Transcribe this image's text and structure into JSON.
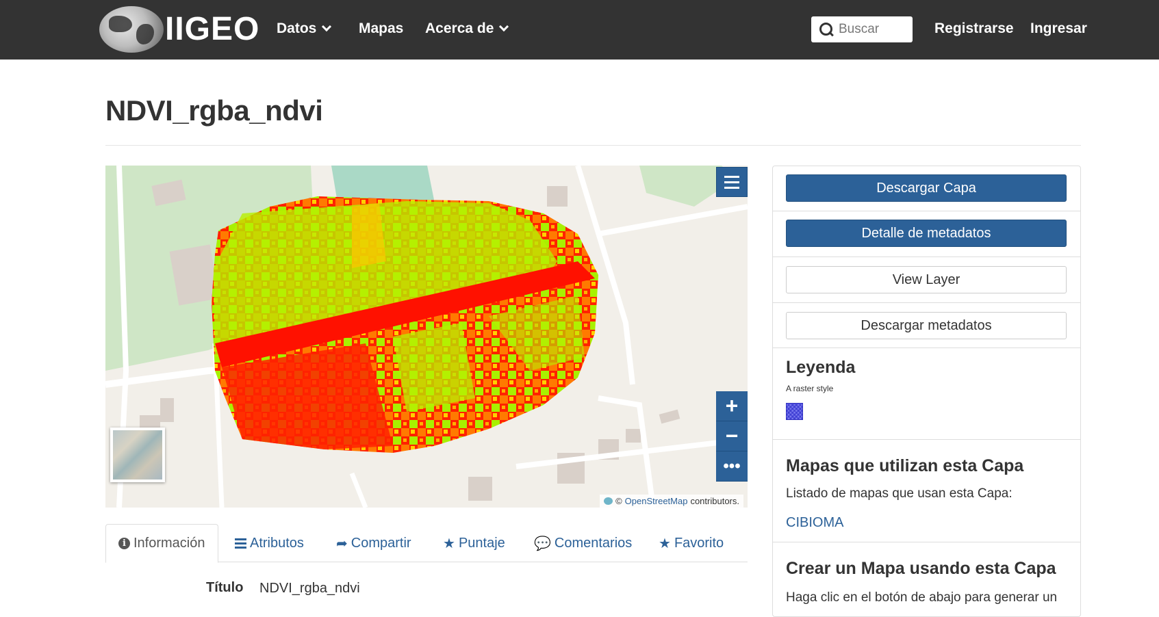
{
  "navbar": {
    "logo_text": "IIGEO",
    "datos": "Datos",
    "mapas": "Mapas",
    "acerca": "Acerca de",
    "search_placeholder": "Buscar",
    "registrarse": "Registrarse",
    "ingresar": "Ingresar"
  },
  "page": {
    "title": "NDVI_rgba_ndvi"
  },
  "map": {
    "attribution_prefix": "©",
    "attribution_link": "OpenStreetMap",
    "attribution_suffix": "contributors."
  },
  "tabs": [
    {
      "label": "Información"
    },
    {
      "label": "Atributos"
    },
    {
      "label": "Compartir"
    },
    {
      "label": "Puntaje"
    },
    {
      "label": "Comentarios"
    },
    {
      "label": "Favorito"
    }
  ],
  "info": {
    "title_label": "Título",
    "title_value": "NDVI_rgba_ndvi"
  },
  "sidebar": {
    "descargar_capa": "Descargar Capa",
    "detalle_metadatos": "Detalle de metadatos",
    "view_layer": "View Layer",
    "descargar_metadatos": "Descargar metadatos",
    "legend_title": "Leyenda",
    "legend_sub": "A raster style",
    "maps_title": "Mapas que utilizan esta Capa",
    "maps_text": "Listado de mapas que usan esta Capa:",
    "maps_link": "CIBIOMA",
    "create_title": "Crear un Mapa usando esta Capa",
    "create_text": "Haga clic en el botón de abajo para generar un"
  },
  "colors": {
    "navbar": "#333333",
    "primary": "#2c6198",
    "ndvi_low": "#ff0000",
    "ndvi_mid": "#ff9900",
    "ndvi_high": "#99ff00"
  }
}
